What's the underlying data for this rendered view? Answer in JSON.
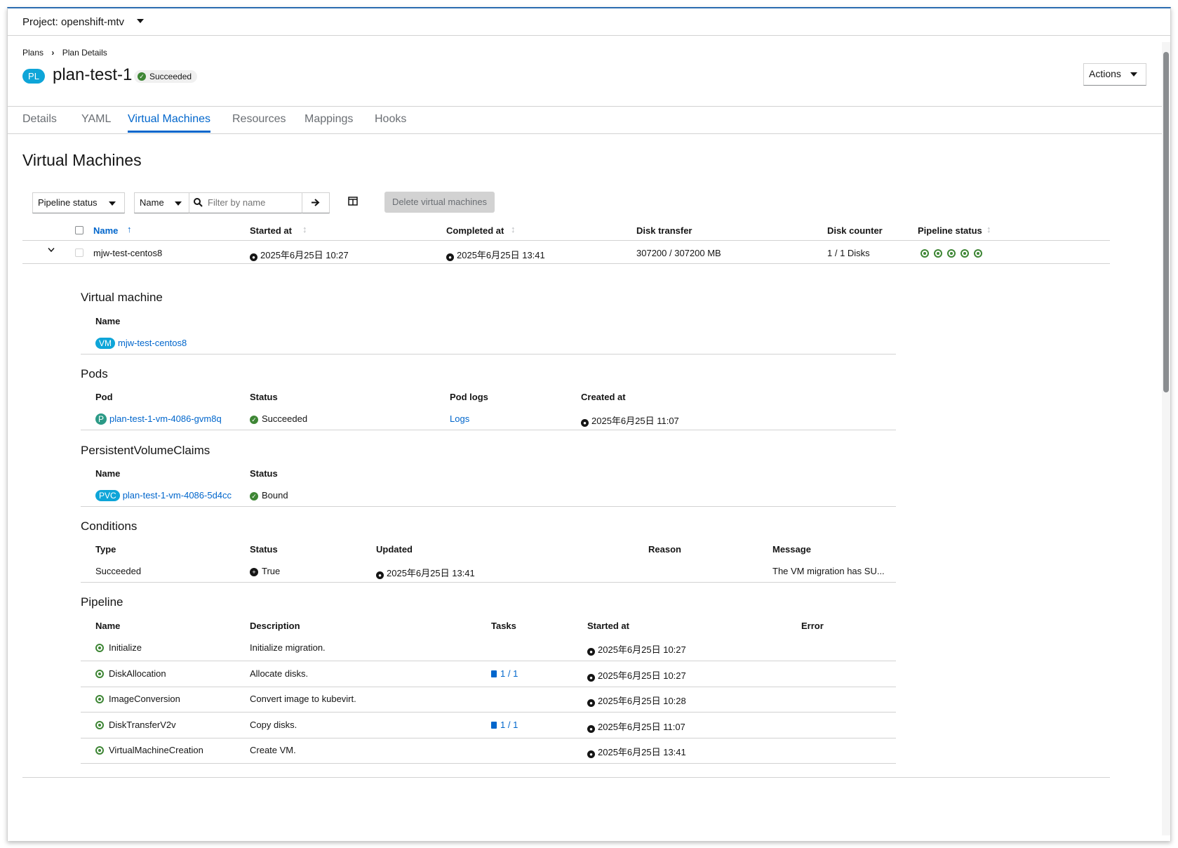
{
  "project": {
    "label": "Project: openshift-mtv"
  },
  "breadcrumb": {
    "root": "Plans",
    "current": "Plan Details"
  },
  "header": {
    "badge": "PL",
    "title": "plan-test-1",
    "status": "Succeeded",
    "actions_label": "Actions"
  },
  "tabs": [
    "Details",
    "YAML",
    "Virtual Machines",
    "Resources",
    "Mappings",
    "Hooks"
  ],
  "active_tab": "Virtual Machines",
  "main": {
    "title": "Virtual Machines",
    "filter_dropdown": "Pipeline status",
    "attr_dropdown": "Name",
    "search_placeholder": "Filter by name",
    "delete_label": "Delete virtual machines"
  },
  "table": {
    "columns": [
      "Name",
      "Started at",
      "Completed at",
      "Disk transfer",
      "Disk counter",
      "Pipeline status"
    ],
    "row": {
      "name": "mjw-test-centos8",
      "started": "2025年6月25日 10:27",
      "completed": "2025年6月25日 13:41",
      "disk_transfer": "307200 / 307200 MB",
      "disk_counter": "1 / 1 Disks",
      "pipeline_steps": 5
    }
  },
  "details": {
    "vm": {
      "title": "Virtual machine",
      "col": "Name",
      "badge": "VM",
      "name": "mjw-test-centos8"
    },
    "pods": {
      "title": "Pods",
      "cols": [
        "Pod",
        "Status",
        "Pod logs",
        "Created at"
      ],
      "badge": "P",
      "pod": "plan-test-1-vm-4086-gvm8q",
      "status": "Succeeded",
      "logs": "Logs",
      "created": "2025年6月25日 11:07"
    },
    "pvc": {
      "title": "PersistentVolumeClaims",
      "cols": [
        "Name",
        "Status"
      ],
      "badge": "PVC",
      "name": "plan-test-1-vm-4086-5d4cc",
      "status": "Bound"
    },
    "conditions": {
      "title": "Conditions",
      "cols": [
        "Type",
        "Status",
        "Updated",
        "Reason",
        "Message"
      ],
      "type": "Succeeded",
      "status": "True",
      "updated": "2025年6月25日 13:41",
      "reason": "",
      "message": "The VM migration has SU..."
    },
    "pipeline": {
      "title": "Pipeline",
      "cols": [
        "Name",
        "Description",
        "Tasks",
        "Started at",
        "Error"
      ],
      "rows": [
        {
          "name": "Initialize",
          "description": "Initialize migration.",
          "tasks": "",
          "started": "2025年6月25日 10:27"
        },
        {
          "name": "DiskAllocation",
          "description": "Allocate disks.",
          "tasks": "1 / 1",
          "started": "2025年6月25日 10:27"
        },
        {
          "name": "ImageConversion",
          "description": "Convert image to kubevirt.",
          "tasks": "",
          "started": "2025年6月25日 10:28"
        },
        {
          "name": "DiskTransferV2v",
          "description": "Copy disks.",
          "tasks": "1 / 1",
          "started": "2025年6月25日 11:07"
        },
        {
          "name": "VirtualMachineCreation",
          "description": "Create VM.",
          "tasks": "",
          "started": "2025年6月25日 13:41"
        }
      ]
    }
  },
  "colors": {
    "link": "#0066cc",
    "success": "#3e8635",
    "badge": "#0ea5d8"
  }
}
